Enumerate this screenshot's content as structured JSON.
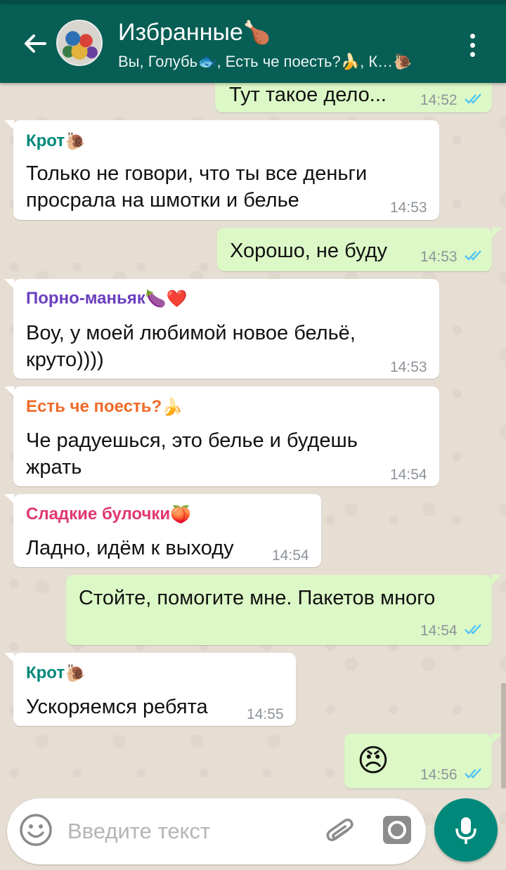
{
  "header": {
    "title": "Избранные",
    "title_emoji": "🍗",
    "subtitle": "Вы, Голубь🐟, Есть че поесть?🍌, К…🐌"
  },
  "messages": [
    {
      "dir": "out",
      "text": "Тут такое дело...",
      "time": "14:52"
    },
    {
      "dir": "in",
      "sender": "Крот",
      "sender_color": "#00897b",
      "text1": "Только не говори, что ты все деньги",
      "text2": "просрала на шмотки и белье",
      "time": "14:53"
    },
    {
      "dir": "out",
      "text": "Хорошо, не буду",
      "time": "14:53"
    },
    {
      "dir": "in",
      "sender": "Порно-маньяк",
      "sender_color": "#6a3fc0",
      "text1": "Воу, у моей любимой новое бельё,",
      "text2": "круто))))",
      "time": "14:53"
    },
    {
      "dir": "in",
      "sender": "Есть че поесть?",
      "sender_color": "#f06a28",
      "text1": "Че радуешься, это белье и будешь",
      "text2": "жрать",
      "time": "14:54"
    },
    {
      "dir": "in",
      "sender": "Сладкие булочки",
      "sender_color": "#e0386f",
      "text": "Ладно, идём к выходу",
      "time": "14:54"
    },
    {
      "dir": "out",
      "text": "Стойте, помогите мне. Пакетов много",
      "time": "14:54"
    },
    {
      "dir": "in",
      "sender": "Крот",
      "sender_color": "#00897b",
      "text": "Ускоряемся ребята",
      "time": "14:55"
    },
    {
      "dir": "out",
      "text": "😠",
      "time": "14:56"
    }
  ],
  "input": {
    "placeholder": "Введите текст"
  },
  "colors": {
    "header": "#075e54",
    "outgoing_bubble": "#dcf8c6",
    "incoming_bubble": "#ffffff",
    "read_ticks": "#4fc3f7",
    "mic_button": "#00897b"
  },
  "icons": [
    "back-arrow-icon",
    "menu-dots-icon",
    "emoji-icon",
    "attach-icon",
    "camera-icon",
    "mic-icon",
    "read-receipt-icon"
  ]
}
